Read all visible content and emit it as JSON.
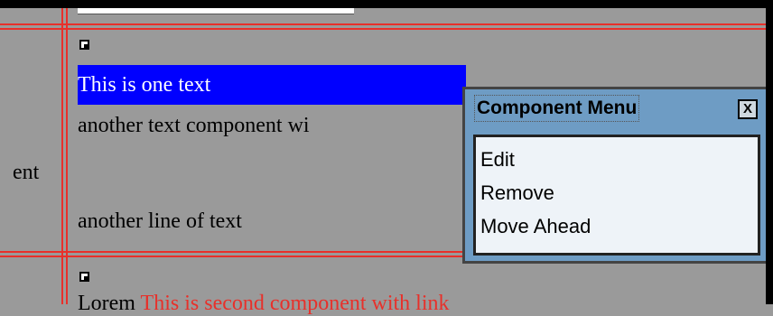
{
  "cell_label": "ent",
  "component": {
    "selected_text": "This is one text",
    "line2": "another text component wi",
    "line3": "another line of text"
  },
  "bottom_row": {
    "text_black": "Lorem ",
    "text_red": "This is second component with link"
  },
  "component_menu": {
    "title": "Component Menu",
    "close_label": "X",
    "items": [
      "Edit",
      "Remove",
      "Move Ahead"
    ]
  },
  "colors": {
    "background": "#9a9a9a",
    "grid": "#e8302a",
    "selection": "#0000ff",
    "menu": "#6e9cc4"
  }
}
